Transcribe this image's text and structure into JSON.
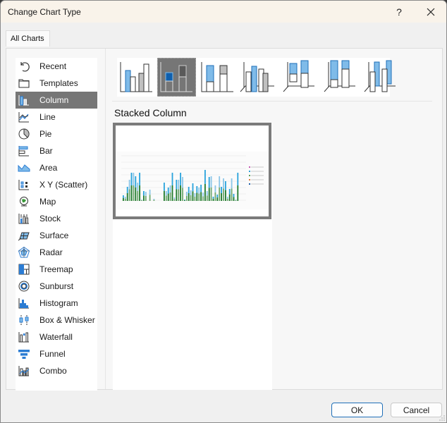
{
  "window": {
    "title": "Change Chart Type",
    "help_label": "?",
    "close_icon": "close-icon"
  },
  "tabs": [
    {
      "label": "All Charts",
      "selected": true
    }
  ],
  "sidebar": {
    "selected": "Column",
    "items": [
      {
        "label": "Recent",
        "icon": "recent-icon"
      },
      {
        "label": "Templates",
        "icon": "templates-folder-icon"
      },
      {
        "label": "Column",
        "icon": "column-chart-icon"
      },
      {
        "label": "Line",
        "icon": "line-chart-icon"
      },
      {
        "label": "Pie",
        "icon": "pie-chart-icon"
      },
      {
        "label": "Bar",
        "icon": "bar-chart-icon"
      },
      {
        "label": "Area",
        "icon": "area-chart-icon"
      },
      {
        "label": "X Y (Scatter)",
        "icon": "scatter-chart-icon"
      },
      {
        "label": "Map",
        "icon": "map-globe-icon"
      },
      {
        "label": "Stock",
        "icon": "stock-chart-icon"
      },
      {
        "label": "Surface",
        "icon": "surface-chart-icon"
      },
      {
        "label": "Radar",
        "icon": "radar-chart-icon"
      },
      {
        "label": "Treemap",
        "icon": "treemap-icon"
      },
      {
        "label": "Sunburst",
        "icon": "sunburst-icon"
      },
      {
        "label": "Histogram",
        "icon": "histogram-icon"
      },
      {
        "label": "Box & Whisker",
        "icon": "box-whisker-icon"
      },
      {
        "label": "Waterfall",
        "icon": "waterfall-icon"
      },
      {
        "label": "Funnel",
        "icon": "funnel-icon"
      },
      {
        "label": "Combo",
        "icon": "combo-chart-icon"
      }
    ]
  },
  "subtypes": {
    "selected_index": 1,
    "selected_name": "Stacked Column",
    "items": [
      {
        "name": "Clustered Column",
        "icon": "clustered-column-icon"
      },
      {
        "name": "Stacked Column",
        "icon": "stacked-column-icon"
      },
      {
        "name": "100% Stacked Column",
        "icon": "100-stacked-column-icon"
      },
      {
        "name": "3-D Clustered Column",
        "icon": "3d-clustered-column-icon"
      },
      {
        "name": "3-D Stacked Column",
        "icon": "3d-stacked-column-icon"
      },
      {
        "name": "3-D 100% Stacked Column",
        "icon": "3d-100-stacked-column-icon"
      },
      {
        "name": "3-D Column",
        "icon": "3d-column-icon"
      }
    ]
  },
  "preview": {
    "description": "Stacked column preview thumbnail",
    "legend_colors": [
      "#c55ab4",
      "#2aa0d8",
      "#5a9e5a",
      "#e07b39",
      "#1f5fa8"
    ],
    "series_colors": [
      "#1f7a2c",
      "#6fa86f",
      "#29a3dc",
      "#8cc6e8",
      "#c55ab4"
    ]
  },
  "buttons": {
    "ok": "OK",
    "cancel": "Cancel"
  },
  "colors": {
    "accent": "#1f6fb8",
    "selection": "#767676",
    "title_bar": "#f9f3ea",
    "chart_blue": "#7fbbe9",
    "chart_blue_dark": "#0f5fad",
    "chart_gray": "#c0c0c0"
  }
}
